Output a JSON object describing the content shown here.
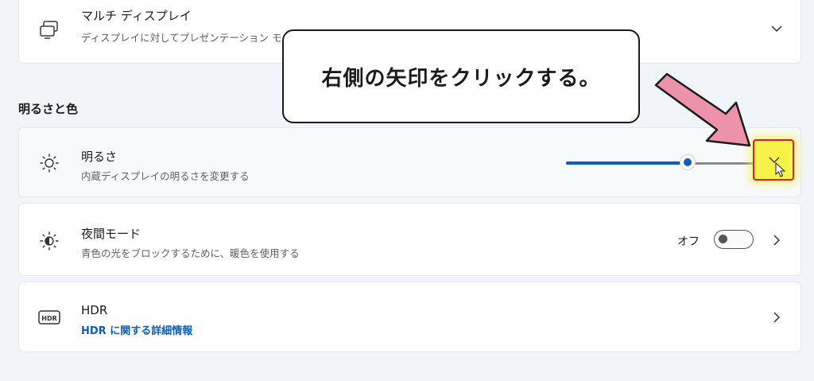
{
  "multi_display": {
    "title": "マルチ ディスプレイ",
    "subtitle": "ディスプレイに対してプレゼンテーション モード"
  },
  "section": {
    "title": "明るさと色"
  },
  "brightness": {
    "title": "明るさ",
    "subtitle": "内蔵ディスプレイの明るさを変更する",
    "level": 0.65
  },
  "night_light": {
    "title": "夜間モード",
    "subtitle": "青色の光をブロックするために、暖色を使用する",
    "state": "オフ"
  },
  "hdr": {
    "title": "HDR",
    "link": "HDR に関する詳細情報",
    "icon_label": "HDR"
  },
  "callout": {
    "text": "右側の矢印をクリックする。"
  },
  "colors": {
    "accent": "#0f5cbf",
    "highlight": "#f7f24a",
    "highlight_border": "#d6202a",
    "arrow": "#ec93ab"
  },
  "icons": {
    "multi_display": "multi-display-icon",
    "brightness": "sun-icon",
    "night_light": "night-light-icon",
    "hdr": "hdr-icon"
  }
}
